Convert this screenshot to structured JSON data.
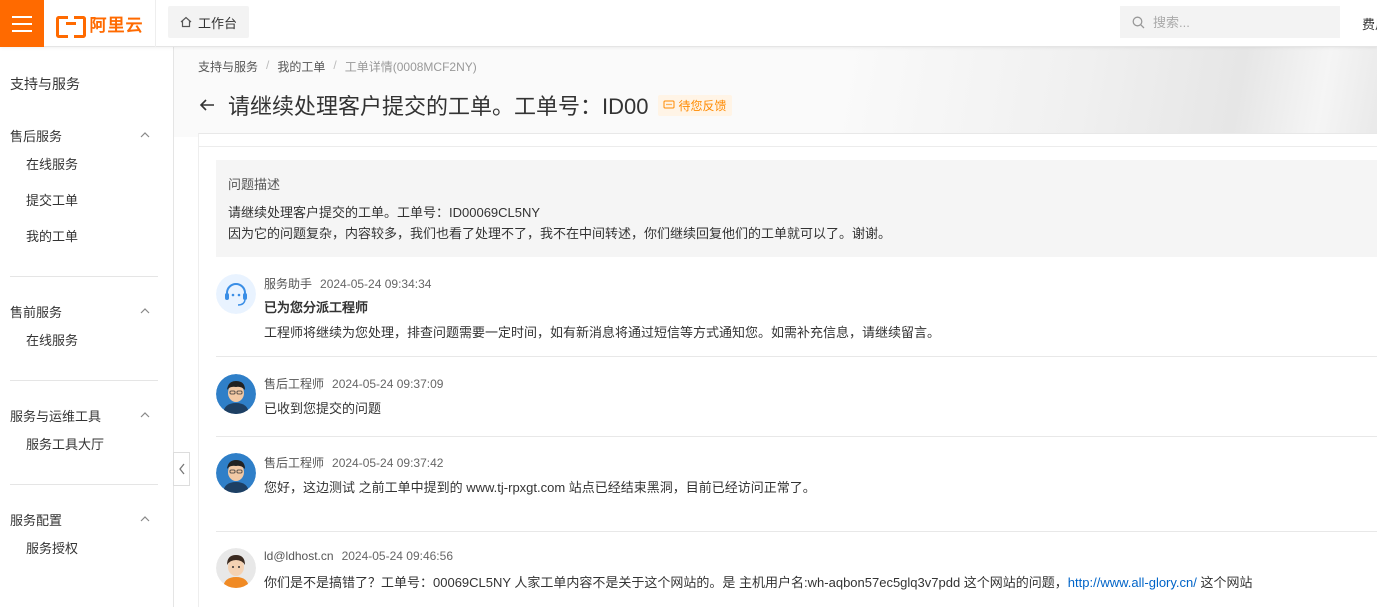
{
  "topbar": {
    "logo_text": "阿里云",
    "workbench_label": "工作台",
    "search_placeholder": "搜索...",
    "fee_label": "费用"
  },
  "sidebar": {
    "title": "支持与服务",
    "groups": [
      {
        "label": "售后服务",
        "items": [
          "在线服务",
          "提交工单",
          "我的工单"
        ]
      },
      {
        "label": "售前服务",
        "items": [
          "在线服务"
        ]
      },
      {
        "label": "服务与运维工具",
        "items": [
          "服务工具大厅"
        ]
      },
      {
        "label": "服务配置",
        "items": [
          "服务授权"
        ]
      }
    ]
  },
  "breadcrumb": {
    "items": [
      "支持与服务",
      "我的工单"
    ],
    "current": "工单详情(0008MCF2NY)"
  },
  "ticket": {
    "title": "请继续处理客户提交的工单。工单号：ID00",
    "status": "待您反馈"
  },
  "description": {
    "label": "问题描述",
    "line1": "请继续处理客户提交的工单。工单号：ID00069CL5NY",
    "line2": "因为它的问题复杂，内容较多，我们也看了处理不了，我不在中间转述，你们继续回复他们的工单就可以了。谢谢。"
  },
  "messages": [
    {
      "author": "服务助手",
      "time": "2024-05-24 09:34:34",
      "headline": "已为您分派工程师",
      "text": "工程师将继续为您处理，排查问题需要一定时间，如有新消息将通过短信等方式通知您。如需补充信息，请继续留言。"
    },
    {
      "author": "售后工程师",
      "time": "2024-05-24 09:37:09",
      "text": "已收到您提交的问题"
    },
    {
      "author": "售后工程师",
      "time": "2024-05-24 09:37:42",
      "text": "您好，这边测试  之前工单中提到的  www.tj-rpxgt.com 站点已经结束黑洞，目前已经访问正常了。"
    },
    {
      "author": "ld@ldhost.cn",
      "time": "2024-05-24 09:46:56",
      "text_before": "你们是不是搞错了？工单号：00069CL5NY  人家工单内容不是关于这个网站的。是 主机用户名:wh-aqbon57ec5glq3v7pdd 这个网站的问题，",
      "link": "http://www.all-glory.cn/",
      "text_after": " 这个网站"
    }
  ],
  "colors": {
    "brand": "#ff6a00",
    "status": "#ff8a00",
    "link": "#0064c8"
  },
  "icons": [
    "menu-icon",
    "home-icon",
    "search-icon",
    "chevron-up-icon",
    "chevron-left-icon",
    "back-arrow-icon",
    "message-icon"
  ]
}
